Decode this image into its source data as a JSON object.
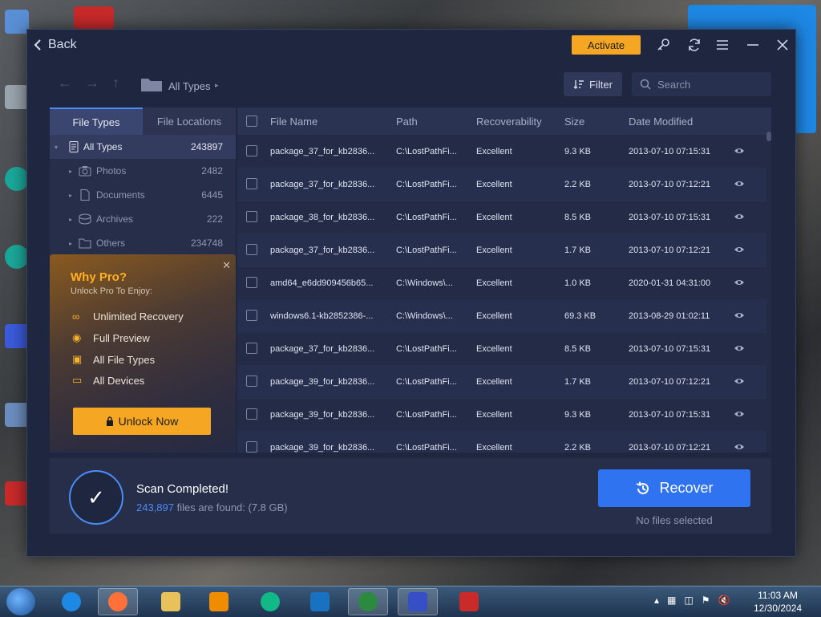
{
  "header": {
    "back_label": "Back",
    "activate_label": "Activate"
  },
  "toolbar": {
    "breadcrumb": "All Types",
    "filter_label": "Filter",
    "search_placeholder": "Search"
  },
  "sidebar": {
    "tabs": [
      "File Types",
      "File Locations"
    ],
    "active_tab": "File Types",
    "items": [
      {
        "label": "All Types",
        "count": "243897",
        "icon": "document-icon",
        "selected": true
      },
      {
        "label": "Photos",
        "count": "2482",
        "icon": "camera-icon",
        "selected": false
      },
      {
        "label": "Documents",
        "count": "6445",
        "icon": "document-icon",
        "selected": false
      },
      {
        "label": "Archives",
        "count": "222",
        "icon": "archive-icon",
        "selected": false
      },
      {
        "label": "Others",
        "count": "234748",
        "icon": "folder-icon",
        "selected": false
      }
    ]
  },
  "promo": {
    "title": "Why Pro?",
    "subtitle": "Unlock Pro To Enjoy:",
    "features": [
      {
        "label": "Unlimited Recovery",
        "icon": "infinity-icon"
      },
      {
        "label": "Full Preview",
        "icon": "eye-icon"
      },
      {
        "label": "All File Types",
        "icon": "folder-icon"
      },
      {
        "label": "All Devices",
        "icon": "device-icon"
      }
    ],
    "button_label": "Unlock Now"
  },
  "table": {
    "columns": [
      "File Name",
      "Path",
      "Recoverability",
      "Size",
      "Date Modified"
    ],
    "rows": [
      {
        "name": "package_37_for_kb2836...",
        "path": "C:\\LostPathFi...",
        "recoverability": "Excellent",
        "size": "9.3 KB",
        "date": "2013-07-10 07:15:31"
      },
      {
        "name": "package_37_for_kb2836...",
        "path": "C:\\LostPathFi...",
        "recoverability": "Excellent",
        "size": "2.2 KB",
        "date": "2013-07-10 07:12:21"
      },
      {
        "name": "package_38_for_kb2836...",
        "path": "C:\\LostPathFi...",
        "recoverability": "Excellent",
        "size": "8.5 KB",
        "date": "2013-07-10 07:15:31"
      },
      {
        "name": "package_37_for_kb2836...",
        "path": "C:\\LostPathFi...",
        "recoverability": "Excellent",
        "size": "1.7 KB",
        "date": "2013-07-10 07:12:21"
      },
      {
        "name": "amd64_e6dd909456b65...",
        "path": "C:\\Windows\\...",
        "recoverability": "Excellent",
        "size": "1.0 KB",
        "date": "2020-01-31 04:31:00"
      },
      {
        "name": "windows6.1-kb2852386-...",
        "path": "C:\\Windows\\...",
        "recoverability": "Excellent",
        "size": "69.3 KB",
        "date": "2013-08-29 01:02:11"
      },
      {
        "name": "package_37_for_kb2836...",
        "path": "C:\\LostPathFi...",
        "recoverability": "Excellent",
        "size": "8.5 KB",
        "date": "2013-07-10 07:15:31"
      },
      {
        "name": "package_39_for_kb2836...",
        "path": "C:\\LostPathFi...",
        "recoverability": "Excellent",
        "size": "1.7 KB",
        "date": "2013-07-10 07:12:21"
      },
      {
        "name": "package_39_for_kb2836...",
        "path": "C:\\LostPathFi...",
        "recoverability": "Excellent",
        "size": "9.3 KB",
        "date": "2013-07-10 07:15:31"
      },
      {
        "name": "package_39_for_kb2836...",
        "path": "C:\\LostPathFi...",
        "recoverability": "Excellent",
        "size": "2.2 KB",
        "date": "2013-07-10 07:12:21"
      }
    ]
  },
  "status": {
    "title": "Scan Completed!",
    "count": "243,897",
    "found_text": "files are found: (7.8 GB)",
    "recover_label": "Recover",
    "selection_text": "No files selected"
  },
  "taskbar": {
    "time": "11:03 AM",
    "date": "12/30/2024"
  },
  "colors": {
    "accent_blue": "#2f73f0",
    "accent_orange": "#f5a623",
    "window_bg": "#1f2640"
  }
}
